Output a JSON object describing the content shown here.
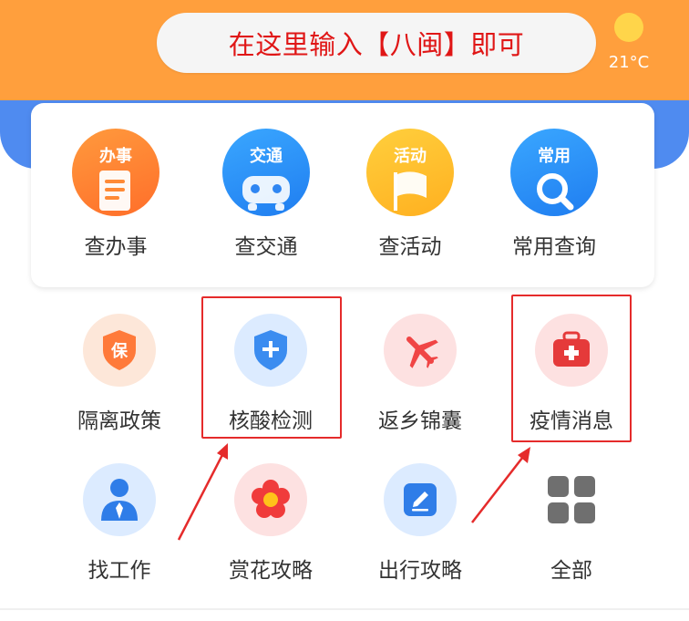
{
  "search": {
    "placeholder_text": "在这里输入【八闽】即可"
  },
  "weather": {
    "temperature": "21°C"
  },
  "primary_services": [
    {
      "tag": "办事",
      "label": "查办事"
    },
    {
      "tag": "交通",
      "label": "查交通"
    },
    {
      "tag": "活动",
      "label": "查活动"
    },
    {
      "tag": "常用",
      "label": "常用查询"
    }
  ],
  "grid_services": [
    {
      "label": "隔离政策",
      "icon": "shield-bao-icon"
    },
    {
      "label": "核酸检测",
      "icon": "shield-plus-icon"
    },
    {
      "label": "返乡锦囊",
      "icon": "airplane-icon"
    },
    {
      "label": "疫情消息",
      "icon": "first-aid-kit-icon"
    },
    {
      "label": "找工作",
      "icon": "person-tie-icon"
    },
    {
      "label": "赏花攻略",
      "icon": "flower-icon"
    },
    {
      "label": "出行攻略",
      "icon": "edit-pencil-icon"
    },
    {
      "label": "全部",
      "icon": "grid-all-icon"
    }
  ],
  "icon_texts": {
    "bao": "保"
  },
  "colors": {
    "header": "#ff9f3d",
    "band": "#4f8bf0",
    "highlight": "#e52b2b",
    "search_text": "#e01616"
  }
}
